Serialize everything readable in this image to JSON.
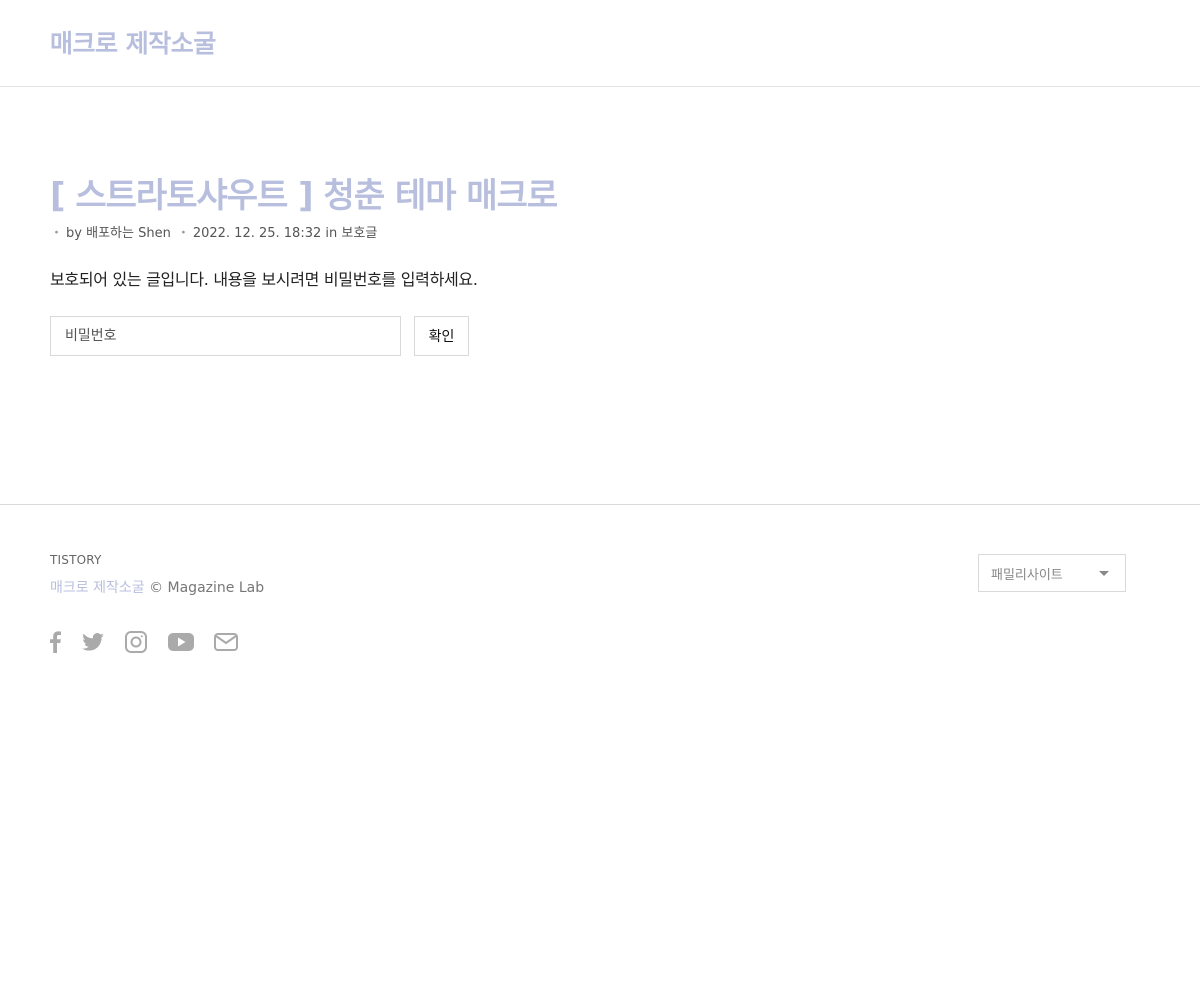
{
  "header": {
    "site_title": "매크로 제작소굴"
  },
  "post": {
    "title": "[ 스트라토샤우트 ] 청춘 테마 매크로",
    "meta": {
      "bullet": "・",
      "by_label": "by",
      "author": "배포하는 Shen",
      "date": "2022. 12. 25. 18:32",
      "in_label": "in",
      "category": "보호글"
    },
    "protected_message": "보호되어 있는 글입니다. 내용을 보시려면 비밀번호를 입력하세요.",
    "password_placeholder": "비밀번호",
    "password_value": "",
    "submit_label": "확인"
  },
  "footer": {
    "brand": "TISTORY",
    "blog_name": "매크로 제작소굴",
    "copyright": "© Magazine Lab",
    "family_site": {
      "selected": "패밀리사이트"
    },
    "social": [
      "facebook-icon",
      "twitter-icon",
      "instagram-icon",
      "youtube-icon",
      "mail-icon"
    ]
  },
  "colors": {
    "accent": "#b8bfde",
    "icon": "#aaaaaa",
    "border": "#d9d9d9"
  }
}
